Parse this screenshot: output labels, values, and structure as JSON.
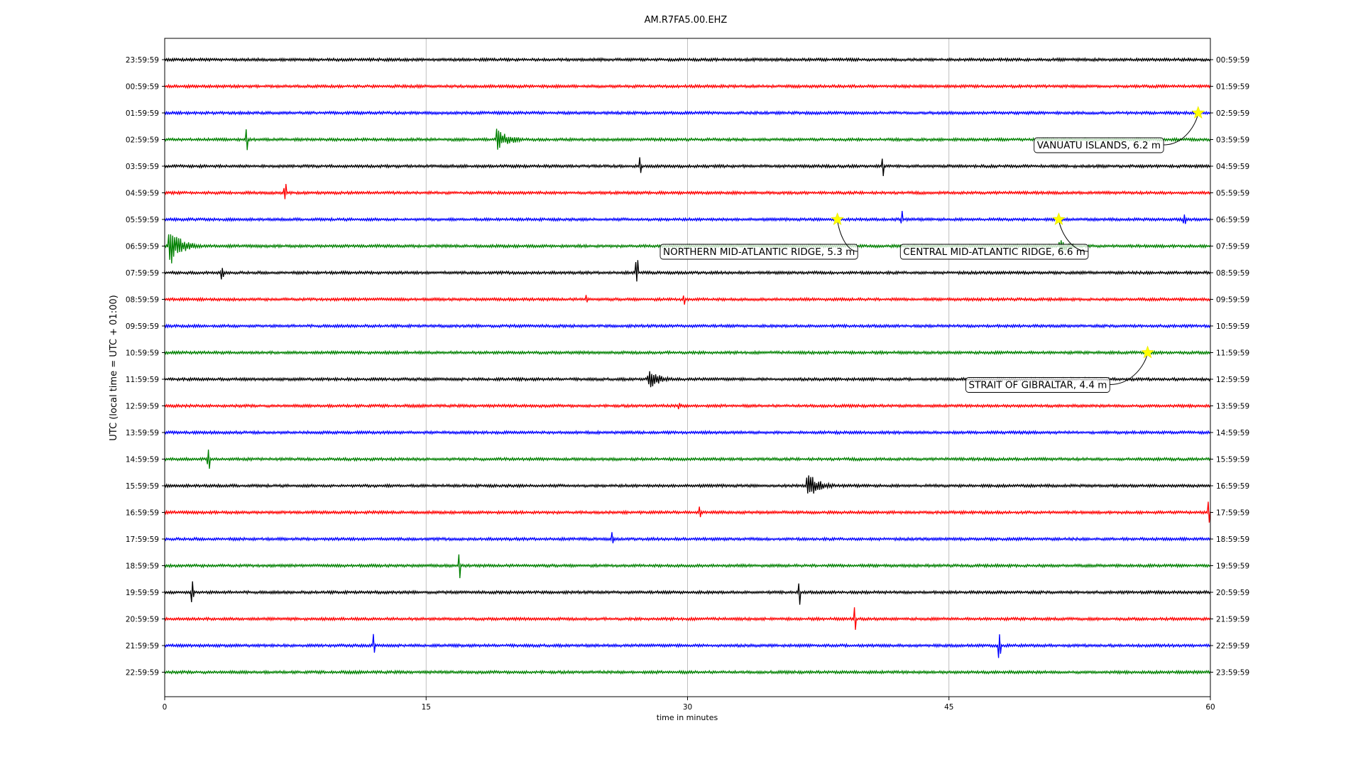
{
  "chart_data": {
    "type": "line",
    "title": "AM.R7FA5.00.EHZ",
    "xlabel": "time in minutes",
    "ylabel": "UTC (local time = UTC + 01:00)",
    "xlim": [
      0,
      60
    ],
    "xticks": [
      0,
      15,
      30,
      45,
      60
    ],
    "grid": "vertical",
    "colors": [
      "#000000",
      "#ff0000",
      "#0000ff",
      "#008000"
    ],
    "left_labels": [
      "23:59:59",
      "00:59:59",
      "01:59:59",
      "02:59:59",
      "03:59:59",
      "04:59:59",
      "05:59:59",
      "06:59:59",
      "07:59:59",
      "08:59:59",
      "09:59:59",
      "10:59:59",
      "11:59:59",
      "12:59:59",
      "13:59:59",
      "14:59:59",
      "15:59:59",
      "16:59:59",
      "17:59:59",
      "18:59:59",
      "19:59:59",
      "20:59:59",
      "21:59:59",
      "22:59:59"
    ],
    "right_labels": [
      "00:59:59",
      "01:59:59",
      "02:59:59",
      "03:59:59",
      "04:59:59",
      "05:59:59",
      "06:59:59",
      "07:59:59",
      "08:59:59",
      "09:59:59",
      "10:59:59",
      "11:59:59",
      "12:59:59",
      "13:59:59",
      "14:59:59",
      "15:59:59",
      "16:59:59",
      "17:59:59",
      "18:59:59",
      "19:59:59",
      "20:59:59",
      "21:59:59",
      "22:59:59",
      "23:59:59"
    ],
    "spikes": [
      {
        "row": 3,
        "minute": 4.7,
        "amp": 1.1
      },
      {
        "row": 3,
        "minute": 19.2,
        "amp": 0.9,
        "burst": true
      },
      {
        "row": 4,
        "minute": 27.3,
        "amp": 0.9
      },
      {
        "row": 4,
        "minute": 41.2,
        "amp": 0.8
      },
      {
        "row": 5,
        "minute": 6.9,
        "amp": 0.7
      },
      {
        "row": 6,
        "minute": 42.3,
        "amp": 0.7
      },
      {
        "row": 6,
        "minute": 58.5,
        "amp": 0.6
      },
      {
        "row": 7,
        "minute": 0.4,
        "amp": 1.5,
        "burst": true
      },
      {
        "row": 7,
        "minute": 51.5,
        "amp": 0.5,
        "burst": true
      },
      {
        "row": 8,
        "minute": 3.3,
        "amp": 0.6
      },
      {
        "row": 8,
        "minute": 27.1,
        "amp": 1.0
      },
      {
        "row": 9,
        "minute": 24.2,
        "amp": 0.5
      },
      {
        "row": 9,
        "minute": 29.8,
        "amp": 0.6
      },
      {
        "row": 12,
        "minute": 27.9,
        "amp": 0.7,
        "burst": true
      },
      {
        "row": 13,
        "minute": 29.5,
        "amp": 0.4
      },
      {
        "row": 15,
        "minute": 2.5,
        "amp": 1.0
      },
      {
        "row": 16,
        "minute": 37.0,
        "amp": 1.0,
        "burst": true
      },
      {
        "row": 17,
        "minute": 30.7,
        "amp": 0.5
      },
      {
        "row": 17,
        "minute": 59.9,
        "amp": 1.0
      },
      {
        "row": 18,
        "minute": 25.7,
        "amp": 0.8
      },
      {
        "row": 19,
        "minute": 16.9,
        "amp": 1.1
      },
      {
        "row": 20,
        "minute": 1.6,
        "amp": 1.0
      },
      {
        "row": 20,
        "minute": 36.4,
        "amp": 1.0
      },
      {
        "row": 21,
        "minute": 39.6,
        "amp": 1.3
      },
      {
        "row": 22,
        "minute": 12.0,
        "amp": 1.0
      },
      {
        "row": 22,
        "minute": 47.9,
        "amp": 1.0
      }
    ],
    "events": [
      {
        "label": "VANUATU ISLANDS, 6.2 m",
        "row": 2,
        "minute": 59.3,
        "label_row": 3.2,
        "label_minute": 53.6
      },
      {
        "label": "NORTHERN MID-ATLANTIC RIDGE, 5.3 m",
        "row": 6,
        "minute": 38.6,
        "label_row": 7.2,
        "label_minute": 34.1
      },
      {
        "label": "CENTRAL MID-ATLANTIC RIDGE, 6.6 m",
        "row": 6,
        "minute": 51.3,
        "label_row": 7.2,
        "label_minute": 47.6
      },
      {
        "label": "STRAIT OF GIBRALTAR, 4.4 m",
        "row": 11,
        "minute": 56.4,
        "label_row": 12.2,
        "label_minute": 50.1
      }
    ]
  }
}
